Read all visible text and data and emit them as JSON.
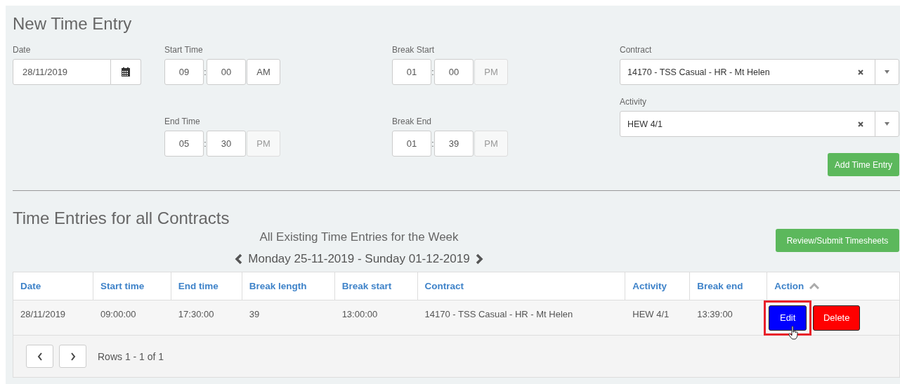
{
  "form": {
    "title": "New Time Entry",
    "date": {
      "label": "Date",
      "value": "28/11/2019"
    },
    "times": [
      {
        "label": "Start Time",
        "hour": "09",
        "minute": "00",
        "meridian": "AM",
        "meridian_disabled": false
      },
      {
        "label": "Break Start",
        "hour": "01",
        "minute": "00",
        "meridian": "PM",
        "meridian_disabled": true
      },
      {
        "label": "End Time",
        "hour": "05",
        "minute": "30",
        "meridian": "PM",
        "meridian_disabled": true
      },
      {
        "label": "Break End",
        "hour": "01",
        "minute": "39",
        "meridian": "PM",
        "meridian_disabled": true
      }
    ],
    "separator": ":",
    "selects": [
      {
        "label": "Contract",
        "value": "14170 - TSS Casual - HR - Mt Helen"
      },
      {
        "label": "Activity",
        "value": "HEW 4/1"
      }
    ],
    "add_button": "Add Time Entry"
  },
  "entries": {
    "title": "Time Entries for all Contracts",
    "subtitle": "All Existing Time Entries for the Week",
    "week": "Monday 25-11-2019 - Sunday 01-12-2019",
    "review_button": "Review/Submit Timesheets",
    "columns": [
      "Date",
      "Start time",
      "End time",
      "Break length",
      "Break start",
      "Contract",
      "Activity",
      "Break end",
      "Action"
    ],
    "rows": [
      {
        "cells": [
          "28/11/2019",
          "09:00:00",
          "17:30:00",
          "39",
          "13:00:00",
          "14170 - TSS Casual - HR - Mt Helen",
          "HEW 4/1",
          "13:39:00"
        ],
        "edit": "Edit",
        "delete": "Delete",
        "edit_highlighted": true
      }
    ],
    "pager": "Rows 1 - 1 of 1"
  }
}
